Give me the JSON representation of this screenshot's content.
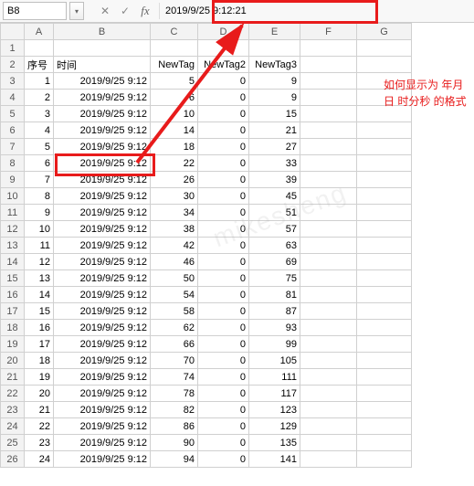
{
  "formula_bar": {
    "name_box": "B8",
    "dropdown_glyph": "▾",
    "cancel_glyph": "✕",
    "accept_glyph": "✓",
    "fx_label": "fx",
    "value": "2019/9/25  9:12:21"
  },
  "columns": [
    "A",
    "B",
    "C",
    "D",
    "E",
    "F",
    "G"
  ],
  "row_numbers": [
    1,
    2,
    3,
    4,
    5,
    6,
    7,
    8,
    9,
    10,
    11,
    12,
    13,
    14,
    15,
    16,
    17,
    18,
    19,
    20,
    21,
    22,
    23,
    24,
    25,
    26
  ],
  "headers": {
    "A": "序号",
    "B": "时间",
    "C": "NewTag",
    "D": "NewTag2",
    "E": "NewTag3"
  },
  "rows": [
    {
      "a": 1,
      "b": "2019/9/25 9:12",
      "c": 5,
      "d": 0,
      "e": 9
    },
    {
      "a": 2,
      "b": "2019/9/25 9:12",
      "c": 6,
      "d": 0,
      "e": 9
    },
    {
      "a": 3,
      "b": "2019/9/25 9:12",
      "c": 10,
      "d": 0,
      "e": 15
    },
    {
      "a": 4,
      "b": "2019/9/25 9:12",
      "c": 14,
      "d": 0,
      "e": 21
    },
    {
      "a": 5,
      "b": "2019/9/25 9:12",
      "c": 18,
      "d": 0,
      "e": 27
    },
    {
      "a": 6,
      "b": "2019/9/25 9:12",
      "c": 22,
      "d": 0,
      "e": 33
    },
    {
      "a": 7,
      "b": "2019/9/25 9:12",
      "c": 26,
      "d": 0,
      "e": 39
    },
    {
      "a": 8,
      "b": "2019/9/25 9:12",
      "c": 30,
      "d": 0,
      "e": 45
    },
    {
      "a": 9,
      "b": "2019/9/25 9:12",
      "c": 34,
      "d": 0,
      "e": 51
    },
    {
      "a": 10,
      "b": "2019/9/25 9:12",
      "c": 38,
      "d": 0,
      "e": 57
    },
    {
      "a": 11,
      "b": "2019/9/25 9:12",
      "c": 42,
      "d": 0,
      "e": 63
    },
    {
      "a": 12,
      "b": "2019/9/25 9:12",
      "c": 46,
      "d": 0,
      "e": 69
    },
    {
      "a": 13,
      "b": "2019/9/25 9:12",
      "c": 50,
      "d": 0,
      "e": 75
    },
    {
      "a": 14,
      "b": "2019/9/25 9:12",
      "c": 54,
      "d": 0,
      "e": 81
    },
    {
      "a": 15,
      "b": "2019/9/25 9:12",
      "c": 58,
      "d": 0,
      "e": 87
    },
    {
      "a": 16,
      "b": "2019/9/25 9:12",
      "c": 62,
      "d": 0,
      "e": 93
    },
    {
      "a": 17,
      "b": "2019/9/25 9:12",
      "c": 66,
      "d": 0,
      "e": 99
    },
    {
      "a": 18,
      "b": "2019/9/25 9:12",
      "c": 70,
      "d": 0,
      "e": 105
    },
    {
      "a": 19,
      "b": "2019/9/25 9:12",
      "c": 74,
      "d": 0,
      "e": 111
    },
    {
      "a": 20,
      "b": "2019/9/25 9:12",
      "c": 78,
      "d": 0,
      "e": 117
    },
    {
      "a": 21,
      "b": "2019/9/25 9:12",
      "c": 82,
      "d": 0,
      "e": 123
    },
    {
      "a": 22,
      "b": "2019/9/25 9:12",
      "c": 86,
      "d": 0,
      "e": 129
    },
    {
      "a": 23,
      "b": "2019/9/25 9:12",
      "c": 90,
      "d": 0,
      "e": 135
    },
    {
      "a": 24,
      "b": "2019/9/25 9:12",
      "c": 94,
      "d": 0,
      "e": 141
    }
  ],
  "annotation": {
    "line1": "如何显示为 年月",
    "line2": "日 时分秒 的格式"
  },
  "watermark": "mikesheng"
}
